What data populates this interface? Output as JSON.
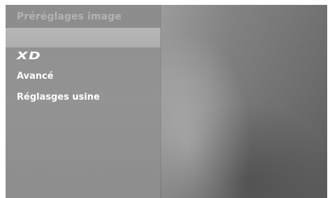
{
  "menu": {
    "title": "Préréglages image",
    "items": [
      {
        "label": "XD"
      },
      {
        "label": "Avancé"
      },
      {
        "label": "Réglasges usine"
      }
    ]
  },
  "colors": {
    "panel": "#8f8f8f",
    "highlight": "#b5b5b5",
    "title_text": "#b3b3b3",
    "item_text": "#ffffff",
    "background": "#9a9a9a"
  }
}
